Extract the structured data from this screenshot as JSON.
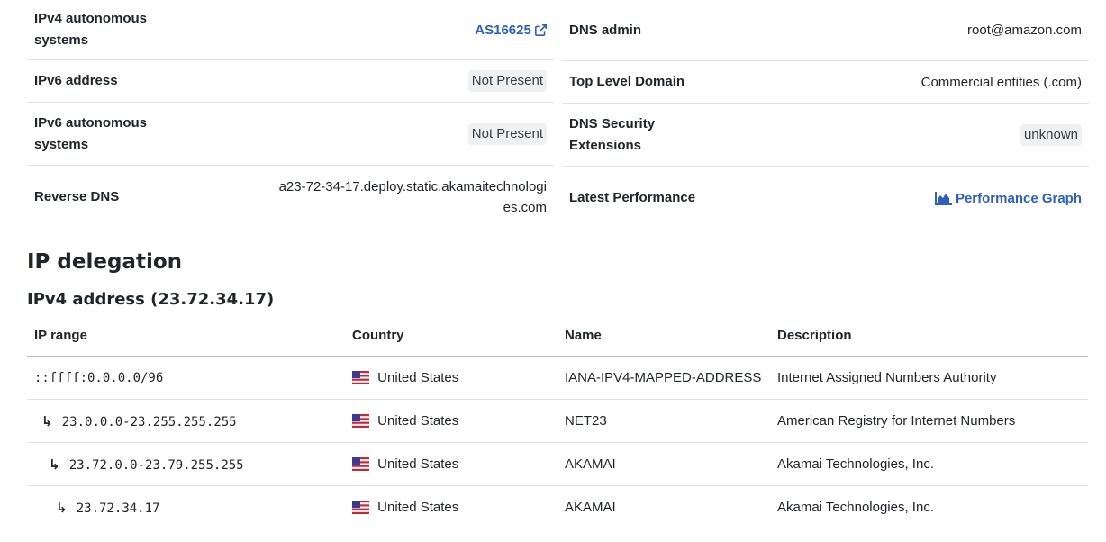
{
  "left_rows": [
    {
      "key": "IPv4 autonomous systems",
      "value": "AS16625",
      "type": "link"
    },
    {
      "key": "IPv6 address",
      "value": "Not Present",
      "type": "pill"
    },
    {
      "key": "IPv6 autonomous systems",
      "value": "Not Present",
      "type": "pill"
    },
    {
      "key": "Reverse DNS",
      "value": "a23-72-34-17.deploy.static.akamaitechnologies.com",
      "type": "text"
    }
  ],
  "right_rows": [
    {
      "key": "DNS admin",
      "value": "root@amazon.com",
      "type": "text"
    },
    {
      "key": "Top Level Domain",
      "value": "Commercial entities (.com)",
      "type": "text"
    },
    {
      "key": "DNS Security Extensions",
      "value": "unknown",
      "type": "pill"
    },
    {
      "key": "Latest Performance",
      "value": "Performance Graph",
      "type": "link"
    }
  ],
  "icons": {
    "as_link": "external-link-icon",
    "performance": "area-chart-icon",
    "flag": "us-flag-icon",
    "child_arrow": "child-arrow-icon"
  },
  "colors": {
    "link": "#2f5fbd",
    "pill_bg": "#eef0f2",
    "border": "#dee2e6"
  },
  "delegation": {
    "title": "IP delegation",
    "subtitle": "IPv4 address (23.72.34.17)",
    "headers": [
      "IP range",
      "Country",
      "Name",
      "Description"
    ],
    "rows": [
      {
        "range": "::ffff:0.0.0.0/96",
        "country": "United States",
        "name": "IANA-IPV4-MAPPED-ADDRESS",
        "description": "Internet Assigned Numbers Authority",
        "depth": 0
      },
      {
        "range": "23.0.0.0-23.255.255.255",
        "country": "United States",
        "name": "NET23",
        "description": "American Registry for Internet Numbers",
        "depth": 1
      },
      {
        "range": "23.72.0.0-23.79.255.255",
        "country": "United States",
        "name": "AKAMAI",
        "description": "Akamai Technologies, Inc.",
        "depth": 2
      },
      {
        "range": "23.72.34.17",
        "country": "United States",
        "name": "AKAMAI",
        "description": "Akamai Technologies, Inc.",
        "depth": 3
      }
    ]
  }
}
